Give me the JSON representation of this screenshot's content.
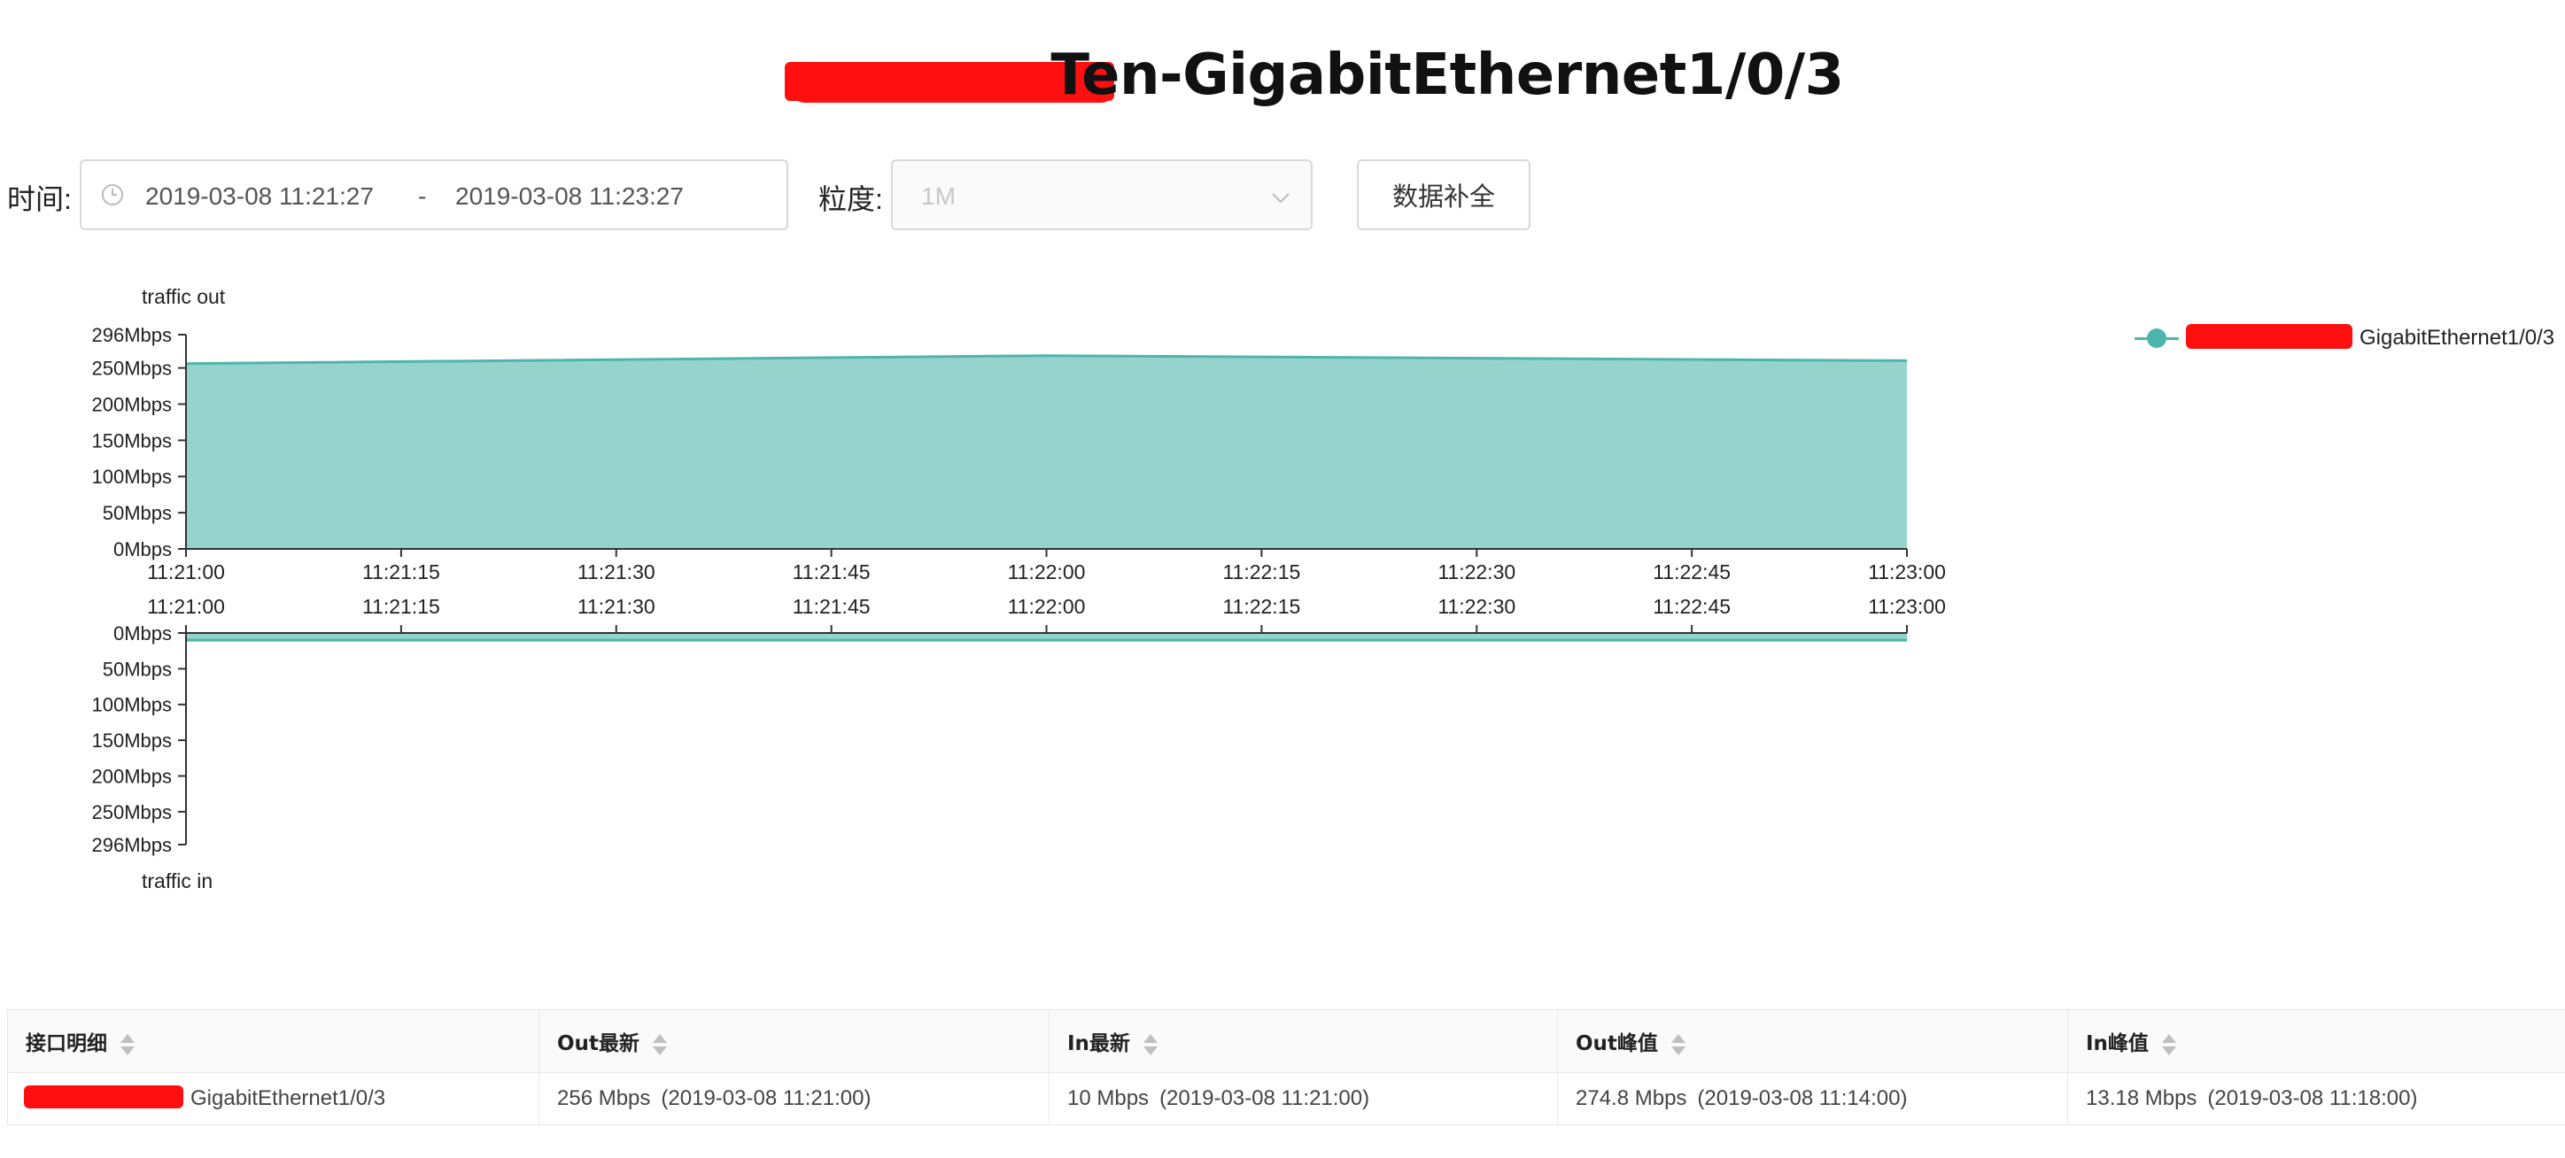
{
  "page": {
    "title": "Ten-GigabitEthernet1/0/3"
  },
  "filters": {
    "time_label": "时间:",
    "time_start": "2019-03-08 11:21:27",
    "time_separator": "-",
    "time_end": "2019-03-08 11:23:27",
    "granularity_label": "粒度:",
    "granularity_value": "1M",
    "supplement_button": "数据补全"
  },
  "legend": {
    "label": "GigabitEthernet1/0/3",
    "color": "#4db6ac"
  },
  "chart_data": [
    {
      "type": "area",
      "title": "traffic out",
      "ylabel": "traffic out",
      "x": [
        "11:21:00",
        "11:21:15",
        "11:21:30",
        "11:21:45",
        "11:22:00",
        "11:22:15",
        "11:22:30",
        "11:22:45",
        "11:23:00"
      ],
      "y_ticks": [
        "0Mbps",
        "50Mbps",
        "100Mbps",
        "150Mbps",
        "200Mbps",
        "250Mbps",
        "296Mbps"
      ],
      "ylim": [
        0,
        296
      ],
      "series": [
        {
          "name": "GigabitEthernet1/0/3",
          "x": [
            "11:21:00",
            "11:22:00",
            "11:23:00"
          ],
          "values": [
            256,
            267,
            260
          ]
        }
      ],
      "color": "#4db6ac",
      "fill": "#95d3cc"
    },
    {
      "type": "area",
      "title": "traffic in",
      "ylabel": "traffic in",
      "orientation": "inverted",
      "x": [
        "11:21:00",
        "11:21:15",
        "11:21:30",
        "11:21:45",
        "11:22:00",
        "11:22:15",
        "11:22:30",
        "11:22:45",
        "11:23:00"
      ],
      "y_ticks": [
        "0Mbps",
        "50Mbps",
        "100Mbps",
        "150Mbps",
        "200Mbps",
        "250Mbps",
        "296Mbps"
      ],
      "ylim": [
        0,
        296
      ],
      "series": [
        {
          "name": "GigabitEthernet1/0/3",
          "x": [
            "11:21:00",
            "11:22:00",
            "11:23:00"
          ],
          "values": [
            10,
            10,
            10
          ]
        }
      ],
      "color": "#4db6ac",
      "fill": "#95d3cc"
    }
  ],
  "table": {
    "headers": [
      "接口明细",
      "Out最新",
      "In最新",
      "Out峰值",
      "In峰值"
    ],
    "rows": [
      {
        "interface": "GigabitEthernet1/0/3",
        "out_latest": "256  Mbps",
        "out_latest_time": "(2019-03-08 11:21:00)",
        "in_latest": "10  Mbps",
        "in_latest_time": "(2019-03-08 11:21:00)",
        "out_peak": "274.8  Mbps",
        "out_peak_time": "(2019-03-08 11:14:00)",
        "in_peak": "13.18  Mbps",
        "in_peak_time": "(2019-03-08 11:18:00)"
      }
    ]
  }
}
